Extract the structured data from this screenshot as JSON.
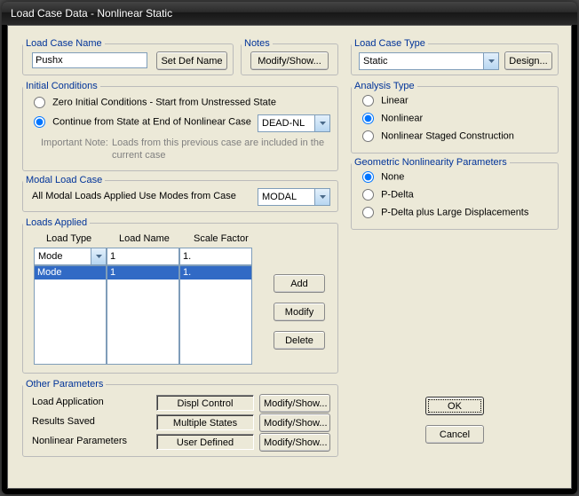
{
  "window": {
    "title": "Load Case Data - Nonlinear Static"
  },
  "loadCaseName": {
    "legend": "Load Case Name",
    "value": "Pushx",
    "setDefName": "Set Def Name"
  },
  "notes": {
    "legend": "Notes",
    "modifyShow": "Modify/Show..."
  },
  "loadCaseType": {
    "legend": "Load Case Type",
    "value": "Static",
    "design": "Design..."
  },
  "initialConditions": {
    "legend": "Initial Conditions",
    "opt1": "Zero Initial Conditions - Start from Unstressed State",
    "opt2": "Continue from State at End of Nonlinear Case",
    "caseDropdown": "DEAD-NL",
    "noteLabel": "Important Note:",
    "noteText1": "Loads from this previous case are included in the",
    "noteText2": "current case"
  },
  "modalLoadCase": {
    "legend": "Modal Load Case",
    "label": "All Modal Loads Applied Use Modes from Case",
    "value": "MODAL"
  },
  "loadsApplied": {
    "legend": "Loads Applied",
    "col1": "Load Type",
    "col2": "Load Name",
    "col3": "Scale Factor",
    "inputType": "Mode",
    "inputName": "1",
    "inputScale": "1.",
    "row": {
      "type": "Mode",
      "name": "1",
      "scale": "1."
    },
    "addBtn": "Add",
    "modifyBtn": "Modify",
    "deleteBtn": "Delete"
  },
  "otherParams": {
    "legend": "Other Parameters",
    "l1": "Load Application",
    "v1": "Displ Control",
    "l2": "Results Saved",
    "v2": "Multiple States",
    "l3": "Nonlinear Parameters",
    "v3": "User Defined",
    "modifyShow": "Modify/Show..."
  },
  "analysisType": {
    "legend": "Analysis Type",
    "o1": "Linear",
    "o2": "Nonlinear",
    "o3": "Nonlinear Staged Construction"
  },
  "geoNonlin": {
    "legend": "Geometric Nonlinearity Parameters",
    "o1": "None",
    "o2": "P-Delta",
    "o3": "P-Delta plus Large Displacements"
  },
  "buttons": {
    "ok": "OK",
    "cancel": "Cancel"
  }
}
